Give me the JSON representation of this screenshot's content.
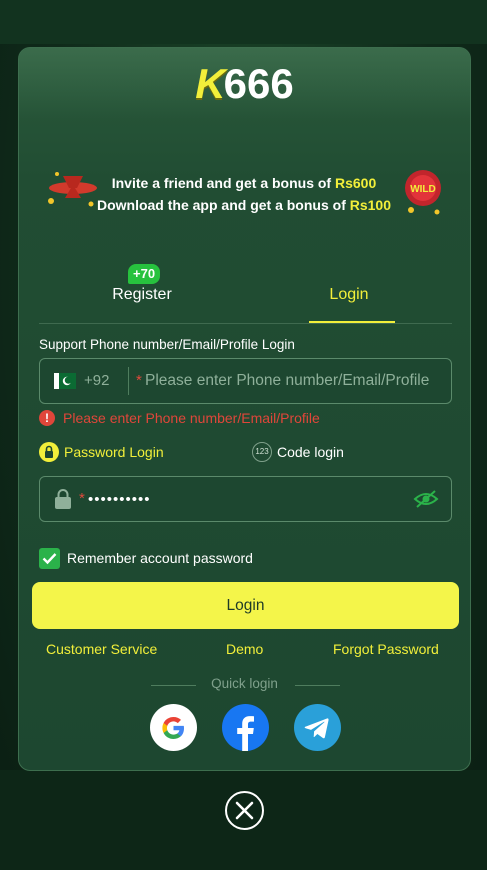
{
  "logo": {
    "k": "K",
    "digits": "666"
  },
  "banner": {
    "line1_prefix": "Invite a friend and get a bonus of ",
    "line1_amount": "Rs600",
    "line2_prefix": "Download the app and get a bonus of ",
    "line2_amount": "Rs100",
    "wild_label": "WILD"
  },
  "tabs": {
    "register": "Register",
    "register_badge": "+70",
    "login": "Login"
  },
  "form": {
    "section_label": "Support Phone number/Email/Profile Login",
    "country_code": "+92",
    "phone_placeholder": "Please enter Phone number/Email/Profile",
    "error": "Please enter Phone number/Email/Profile",
    "password_login": "Password Login",
    "code_login": "Code login",
    "code_icon": "123",
    "password_value": "••••••••••",
    "remember": "Remember account password",
    "login_button": "Login"
  },
  "links": {
    "customer_service": "Customer Service",
    "demo": "Demo",
    "forgot_password": "Forgot Password"
  },
  "quick_login": {
    "label": "Quick login",
    "providers": [
      "google-icon",
      "facebook-icon",
      "telegram-icon"
    ]
  },
  "colors": {
    "accent_yellow": "#f2ef3a",
    "button_yellow": "#f4f54a",
    "panel_green": "#1d4730",
    "error_red": "#e0463a",
    "check_green": "#2bb24a"
  }
}
